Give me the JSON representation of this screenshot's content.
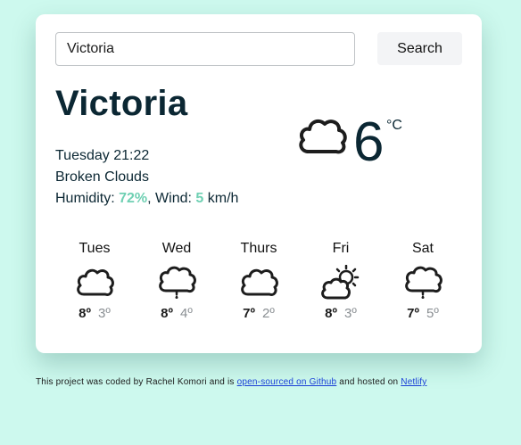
{
  "search": {
    "value": "Victoria",
    "placeholder": "",
    "button_label": "Search"
  },
  "current": {
    "city": "Victoria",
    "datetime": "Tuesday 21:22",
    "description": "Broken Clouds",
    "humidity_label": "Humidity: ",
    "humidity_value": "72%",
    "wind_label": ", Wind: ",
    "wind_value": "5",
    "wind_unit": " km/h",
    "temperature": "6",
    "unit": "°C",
    "icon": "cloud-icon"
  },
  "forecast": [
    {
      "day": "Tues",
      "max": "8º",
      "min": "3º",
      "icon": "cloud-icon"
    },
    {
      "day": "Wed",
      "max": "8º",
      "min": "4º",
      "icon": "rain-cloud-icon"
    },
    {
      "day": "Thurs",
      "max": "7º",
      "min": "2º",
      "icon": "cloud-icon"
    },
    {
      "day": "Fri",
      "max": "8º",
      "min": "3º",
      "icon": "partly-sunny-icon"
    },
    {
      "day": "Sat",
      "max": "7º",
      "min": "5º",
      "icon": "rain-cloud-icon"
    }
  ],
  "footer": {
    "text_1": "This project was coded by Rachel Komori and is ",
    "link_1": "open-sourced on Github",
    "text_2": " and hosted on ",
    "link_2": "Netlify"
  },
  "colors": {
    "background": "#cdf9ee",
    "accent": "#6fd0b3",
    "text": "#0b2733"
  }
}
